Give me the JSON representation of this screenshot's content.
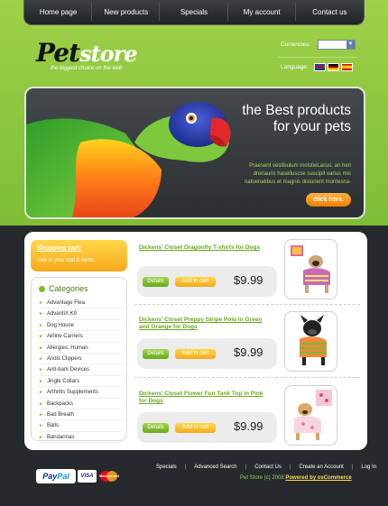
{
  "nav": {
    "items": [
      "Home page",
      "New products",
      "Specials",
      "My account",
      "Contact us"
    ]
  },
  "header": {
    "logo_pet": "Pet",
    "logo_store": "store",
    "tagline": "the biggest choice on the web",
    "currencies_label": "Currencies:",
    "currency_value": "",
    "language_label": "Language:"
  },
  "banner": {
    "title_line1": "the Best products",
    "title_line2": "for your pets",
    "text": "Praesent vestibulum molstieLacus. an hen dreriauris  haselluscse suscipit varius mis natoenatibus et magnis disturient montesna-",
    "button": "click here."
  },
  "cart": {
    "title": "Shopping cart:",
    "subtitle": "now in your cart 0 items"
  },
  "categories": {
    "title": "Categories",
    "items": [
      "Advantage Flea",
      "AdvantiX K9",
      "Dog House",
      "Airline Carriers",
      "Allergies: Human",
      "Andis Clippers",
      "Anti-bark Devices",
      "Jingle Collars",
      "Arthritis Supplements",
      "Backpacks",
      "Bad Breath",
      "Balls",
      "Bandannas"
    ]
  },
  "products": [
    {
      "title": "Dickens' Closet Dragonfly T-shirts for Dogs",
      "details": "Details",
      "add": "Add to cart",
      "price": "$9.99"
    },
    {
      "title": "Dickens' Closet Preppy Stripe Polo in Green and Orange for Dogs",
      "details": "Details",
      "add": "Add to cart",
      "price": "$9.99"
    },
    {
      "title": "Dickens' Closet Flower Fun Tank Top in Pink for Dogs",
      "details": "Details",
      "add": "Add to cart",
      "price": "$9.99"
    }
  ],
  "footer": {
    "links": [
      "Specials",
      "Advanced Search",
      "Contact Us",
      "Create an Account",
      "Log In"
    ],
    "copyright": "Pet Store (c) 2008",
    "powered": "Powered by osCommerce",
    "paypal_pay": "Pay",
    "paypal_pal": "Pal",
    "visa": "VISA",
    "mastercard": "MasterCard"
  }
}
